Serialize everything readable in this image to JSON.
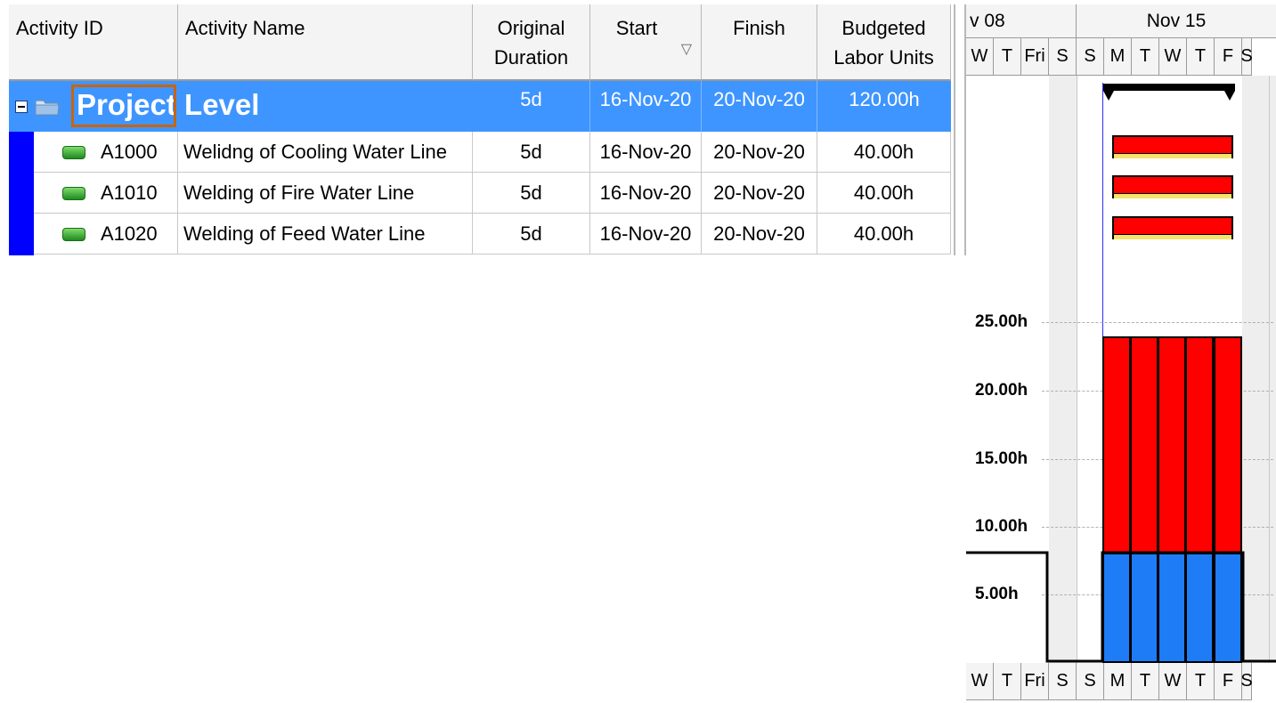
{
  "table": {
    "headers": {
      "activity_id": "Activity ID",
      "activity_name": "Activity Name",
      "original_duration": [
        "Original",
        "Duration"
      ],
      "start": "Start",
      "finish": "Finish",
      "budgeted_labor_units": [
        "Budgeted",
        "Labor Units"
      ]
    },
    "project": {
      "name_part1": "Project",
      "name_part2": "Level",
      "duration": "5d",
      "start": "16-Nov-20",
      "finish": "20-Nov-20",
      "labor_units": "120.00h"
    },
    "activities": [
      {
        "id": "A1000",
        "name": "Welidng of Cooling Water Line",
        "duration": "5d",
        "start": "16-Nov-20",
        "finish": "20-Nov-20",
        "labor_units": "40.00h"
      },
      {
        "id": "A1010",
        "name": "Welding of Fire Water Line",
        "duration": "5d",
        "start": "16-Nov-20",
        "finish": "20-Nov-20",
        "labor_units": "40.00h"
      },
      {
        "id": "A1020",
        "name": "Welding of Feed Water Line",
        "duration": "5d",
        "start": "16-Nov-20",
        "finish": "20-Nov-20",
        "labor_units": "40.00h"
      }
    ]
  },
  "gantt": {
    "weeks": [
      "v 08",
      "Nov 15"
    ],
    "days": [
      "W",
      "T",
      "Fri",
      "S",
      "S",
      "M",
      "T",
      "W",
      "T",
      "F",
      "S"
    ]
  },
  "histogram": {
    "y_labels": [
      "25.00h",
      "20.00h",
      "15.00h",
      "10.00h",
      "5.00h"
    ],
    "colors": {
      "remaining": "#ff0000",
      "actual_limit": "#1e7cf6"
    }
  }
}
